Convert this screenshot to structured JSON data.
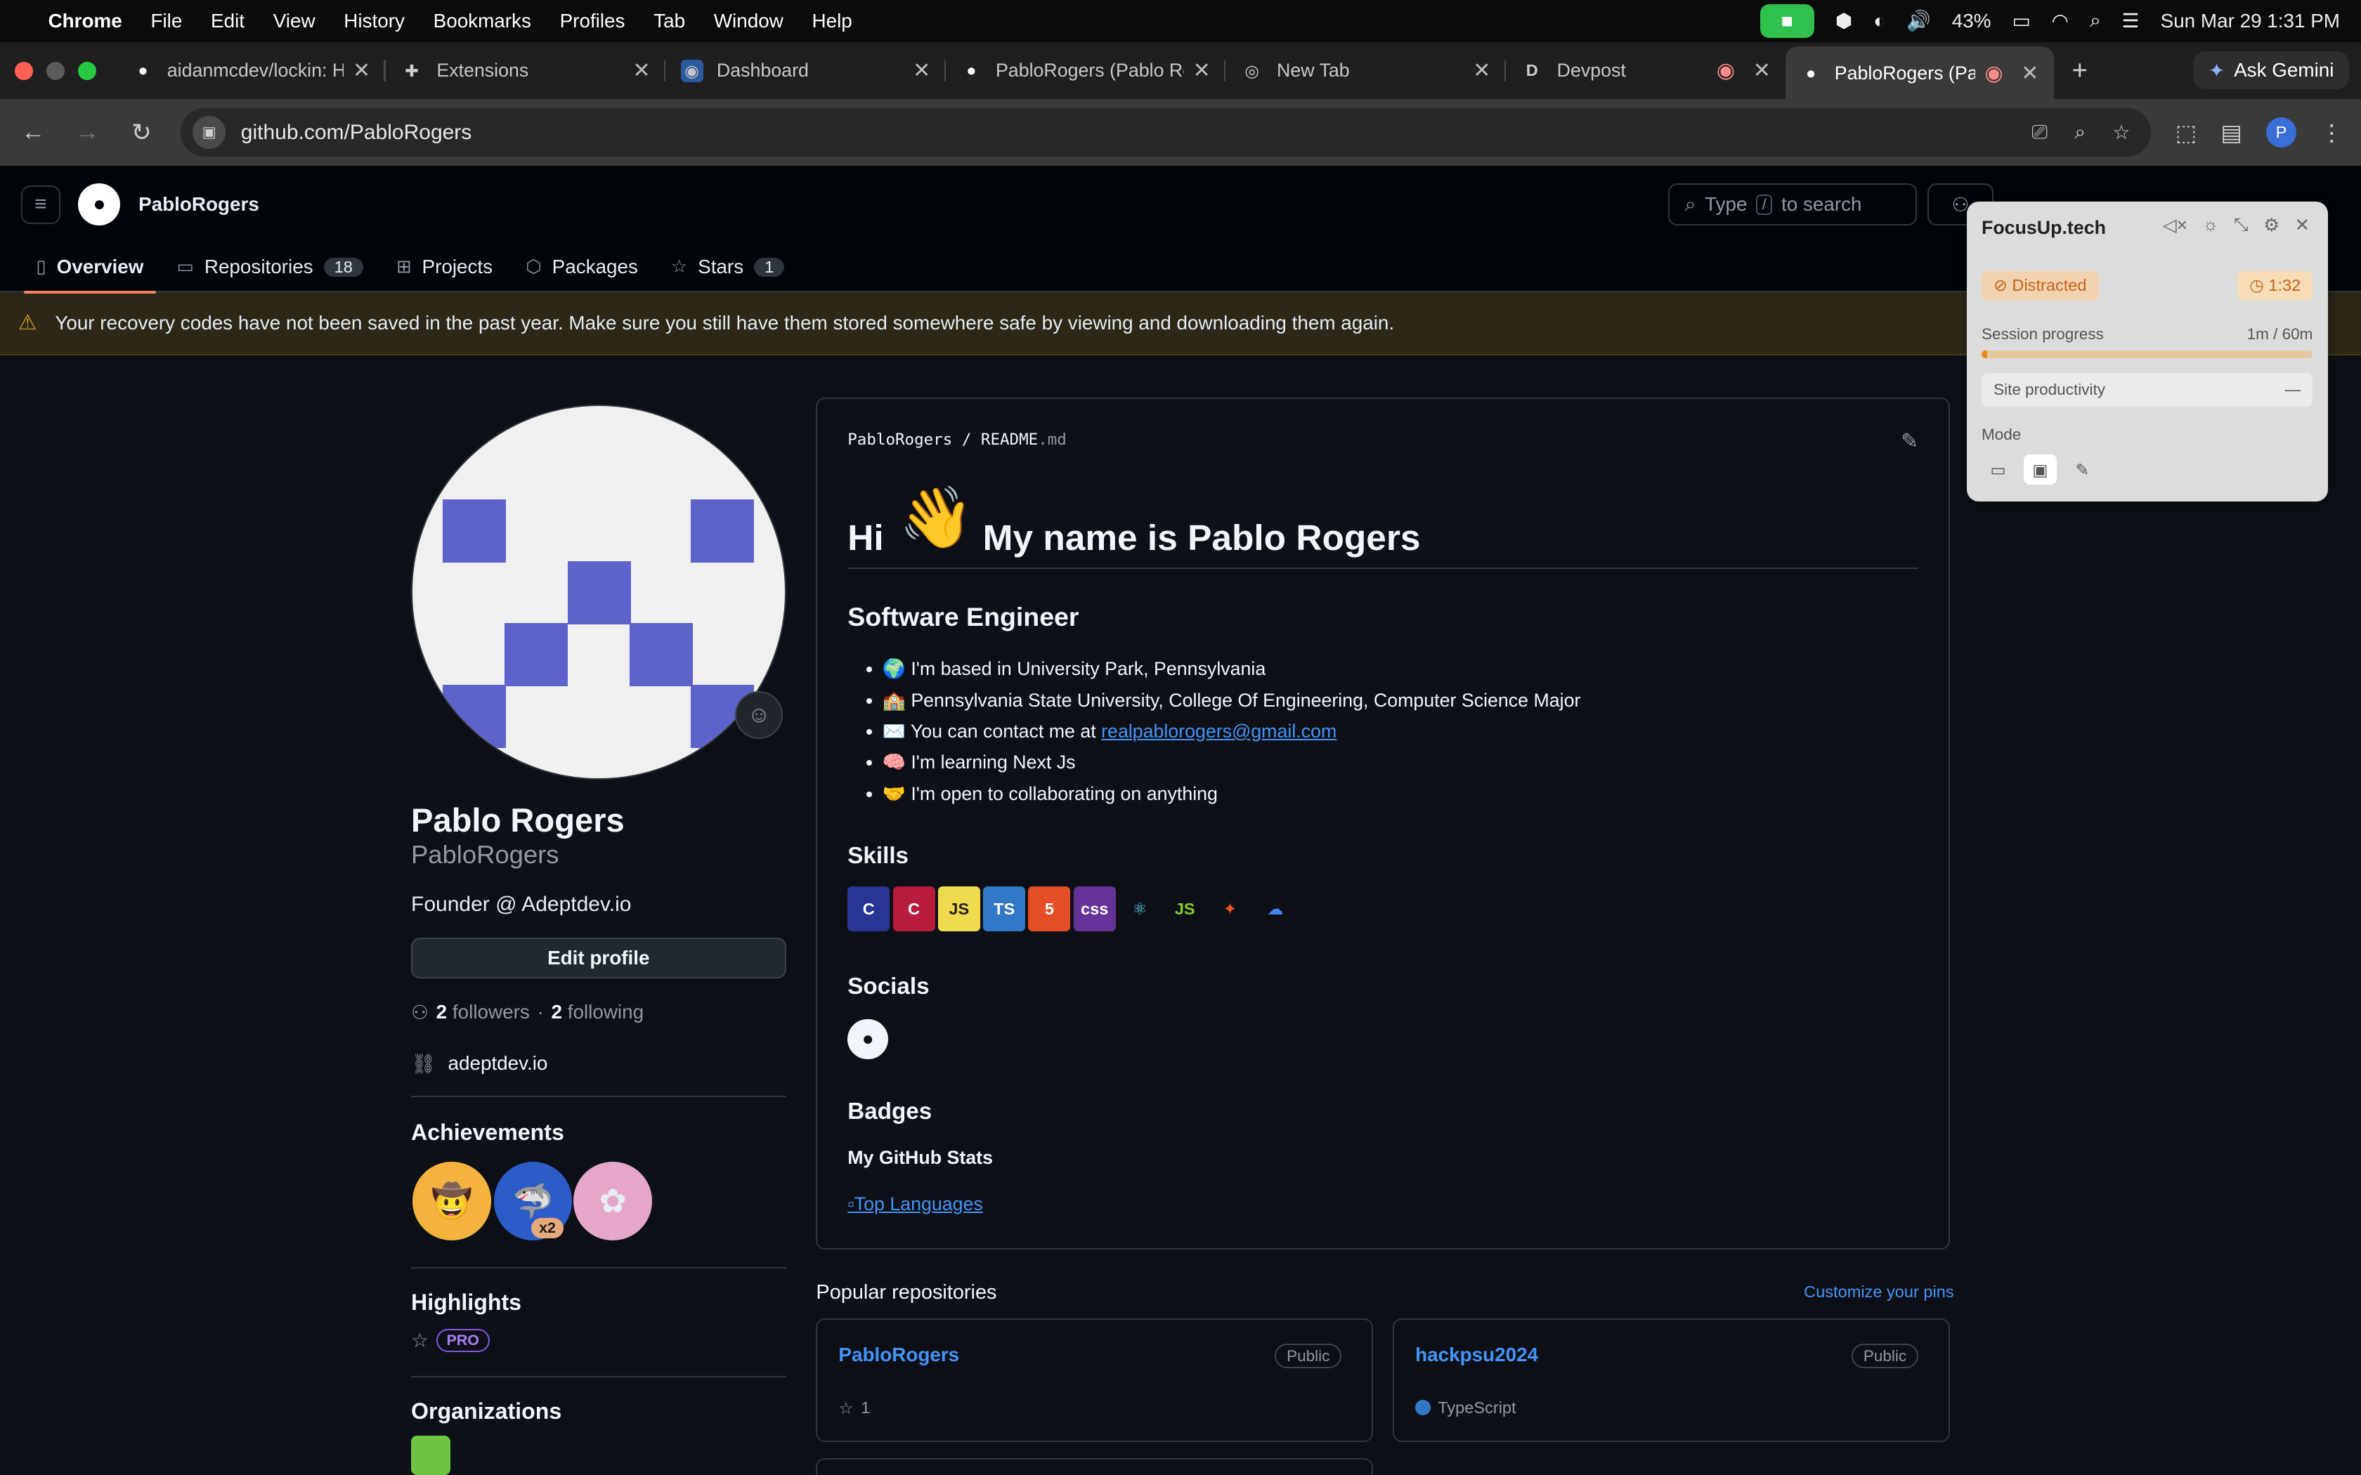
{
  "menubar": {
    "app": "Chrome",
    "items": [
      "File",
      "Edit",
      "View",
      "History",
      "Bookmarks",
      "Profiles",
      "Tab",
      "Window",
      "Help"
    ],
    "battery": "43%",
    "datetime": "Sun Mar 29  1:31 PM"
  },
  "tabs": [
    {
      "title": "aidanmcdev/lockin: Ha",
      "icon": "github-icon"
    },
    {
      "title": "Extensions",
      "icon": "puzzle-icon"
    },
    {
      "title": "Dashboard",
      "icon": "dashboard-icon"
    },
    {
      "title": "PabloRogers (Pablo Ro",
      "icon": "github-icon"
    },
    {
      "title": "New Tab",
      "icon": "chrome-icon"
    },
    {
      "title": "Devpost",
      "icon": "devpost-icon"
    },
    {
      "title": "PabloRogers (Pabl",
      "icon": "github-icon",
      "active": true
    }
  ],
  "gemini_label": "Ask Gemini",
  "url": "github.com/PabloRogers",
  "profile_initial": "P",
  "gh": {
    "header_user": "PabloRogers",
    "search_placeholder_pre": "Type",
    "search_key": "/",
    "search_placeholder_post": "to search",
    "nav": {
      "overview": "Overview",
      "repositories": "Repositories",
      "repositories_count": "18",
      "projects": "Projects",
      "packages": "Packages",
      "stars": "Stars",
      "stars_count": "1"
    },
    "banner": "Your recovery codes have not been saved in the past year. Make sure you still have them stored somewhere safe by viewing and downloading them again."
  },
  "profile": {
    "name": "Pablo Rogers",
    "login": "PabloRogers",
    "bio": "Founder @ Adeptdev.io",
    "edit_button": "Edit profile",
    "followers_count": "2",
    "followers_label": "followers",
    "following_count": "2",
    "following_label": "following",
    "website": "adeptdev.io",
    "achievements_title": "Achievements",
    "achievement_multiplier": "x2",
    "highlights_title": "Highlights",
    "pro_badge": "PRO",
    "organizations_title": "Organizations"
  },
  "readme": {
    "path_user": "PabloRogers",
    "path_sep": "/",
    "path_file": "README",
    "path_ext": ".md",
    "h1_pre": "Hi",
    "wave": "👋",
    "h1_post": "My name is Pablo Rogers",
    "subtitle": "Software Engineer",
    "bullets": [
      {
        "emoji": "🌍",
        "text": "I'm based in University Park, Pennsylvania"
      },
      {
        "emoji": "🏫",
        "text": "Pennsylvania State University, College Of Engineering, Computer Science Major"
      },
      {
        "emoji": "✉️",
        "text": "You can contact me at ",
        "link": "realpablorogers@gmail.com"
      },
      {
        "emoji": "🧠",
        "text": "I'm learning Next Js"
      },
      {
        "emoji": "🤝",
        "text": "I'm open to collaborating on anything"
      }
    ],
    "skills_title": "Skills",
    "skills": [
      {
        "name": "c-icon",
        "label": "C",
        "bg": "#283593",
        "fg": "#ffffff"
      },
      {
        "name": "cpp-icon",
        "label": "C",
        "bg": "#b71c3c",
        "fg": "#ffffff"
      },
      {
        "name": "javascript-icon",
        "label": "JS",
        "bg": "#f0db4f",
        "fg": "#222222"
      },
      {
        "name": "typescript-icon",
        "label": "TS",
        "bg": "#3178c6",
        "fg": "#ffffff"
      },
      {
        "name": "html5-icon",
        "label": "5",
        "bg": "#e44d26",
        "fg": "#ffffff"
      },
      {
        "name": "css-icon",
        "label": "css",
        "bg": "#663399",
        "fg": "#ffffff"
      },
      {
        "name": "react-icon",
        "label": "⚛",
        "bg": "#0d1117",
        "fg": "#61dafb"
      },
      {
        "name": "nodejs-icon",
        "label": "JS",
        "bg": "#0d1117",
        "fg": "#83cd29"
      },
      {
        "name": "figma-icon",
        "label": "✦",
        "bg": "#0d1117",
        "fg": "#f24e1e"
      },
      {
        "name": "google-cloud-icon",
        "label": "☁",
        "bg": "#0d1117",
        "fg": "#4285f4"
      }
    ],
    "socials_title": "Socials",
    "badges_title": "Badges",
    "stats_title": "My GitHub Stats",
    "top_languages": "Top Languages"
  },
  "popular": {
    "title": "Popular repositories",
    "customize": "Customize your pins",
    "repos": [
      {
        "name": "PabloRogers",
        "visibility": "Public",
        "stars": "1"
      },
      {
        "name": "hackpsu2024",
        "visibility": "Public",
        "language": "TypeScript"
      }
    ]
  },
  "focus": {
    "title": "FocusUp.tech",
    "status": "Distracted",
    "timer": "1:32",
    "progress_label": "Session progress",
    "progress_value": "1m / 60m",
    "progress_fraction": 0.017,
    "site_label": "Site productivity",
    "site_value": "—",
    "mode_label": "Mode"
  }
}
